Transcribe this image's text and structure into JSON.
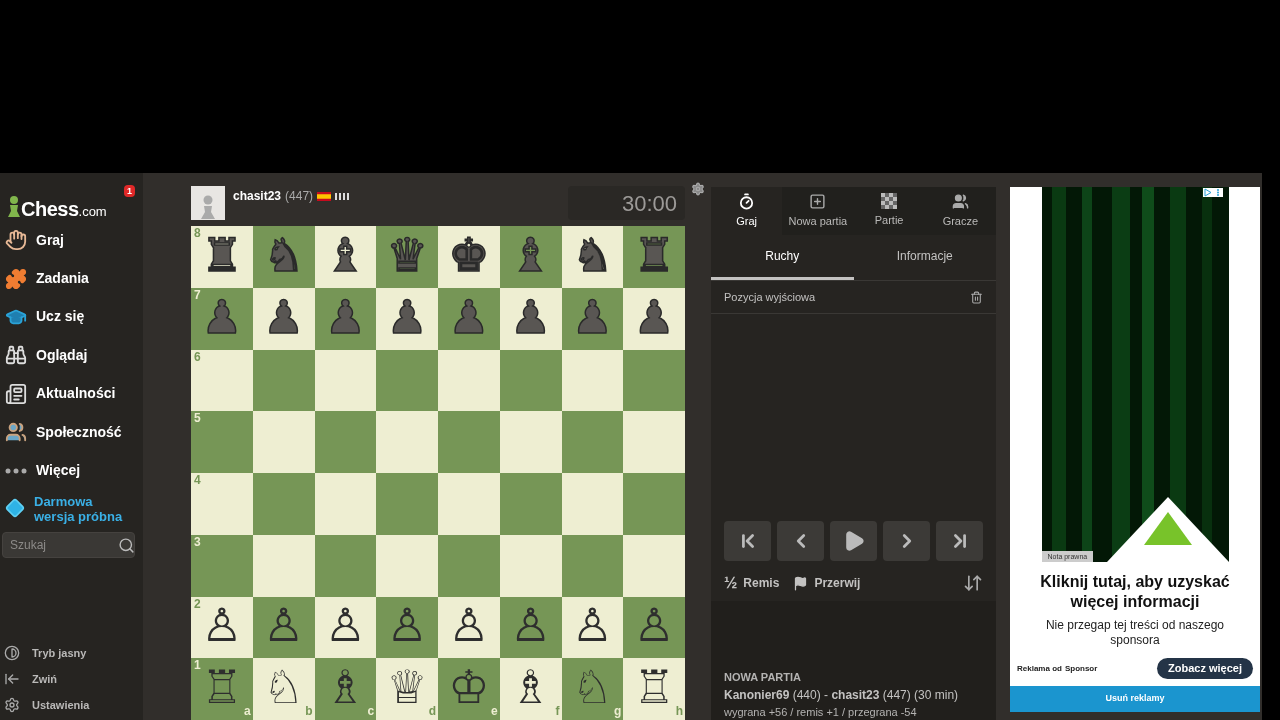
{
  "sidebar": {
    "logo": "Chess",
    "logo_suffix": ".com",
    "notification_count": "1",
    "items": [
      {
        "label": "Graj"
      },
      {
        "label": "Zadania"
      },
      {
        "label": "Ucz się"
      },
      {
        "label": "Oglądaj"
      },
      {
        "label": "Aktualności"
      },
      {
        "label": "Społeczność"
      },
      {
        "label": "Więcej"
      }
    ],
    "trial": "Darmowa wersja próbna",
    "search": {
      "placeholder": "Szukaj"
    },
    "bottom_items": [
      {
        "label": "Tryb jasny"
      },
      {
        "label": "Zwiń"
      },
      {
        "label": "Ustawienia"
      }
    ]
  },
  "player": {
    "name": "chasit23",
    "rating": "(447)",
    "clock": "30:00"
  },
  "board": {
    "ranks": [
      {
        "label": "8",
        "squares": [
          {
            "piece": "♜",
            "kind": "black"
          },
          {
            "piece": "♞",
            "kind": "black"
          },
          {
            "piece": "♝",
            "kind": "black"
          },
          {
            "piece": "♛",
            "kind": "black"
          },
          {
            "piece": "♚",
            "kind": "black"
          },
          {
            "piece": "♝",
            "kind": "black"
          },
          {
            "piece": "♞",
            "kind": "black"
          },
          {
            "piece": "♜",
            "kind": "black"
          }
        ]
      },
      {
        "label": "7",
        "squares": [
          {
            "piece": "♟",
            "kind": "black"
          },
          {
            "piece": "♟",
            "kind": "black"
          },
          {
            "piece": "♟",
            "kind": "black"
          },
          {
            "piece": "♟",
            "kind": "black"
          },
          {
            "piece": "♟",
            "kind": "black"
          },
          {
            "piece": "♟",
            "kind": "black"
          },
          {
            "piece": "♟",
            "kind": "black"
          },
          {
            "piece": "♟",
            "kind": "black"
          }
        ]
      },
      {
        "label": "6"
      },
      {
        "label": "5"
      },
      {
        "label": "4"
      },
      {
        "label": "3"
      },
      {
        "label": "2",
        "squares": [
          {
            "piece": "♙",
            "kind": "white"
          },
          {
            "piece": "♙",
            "kind": "white"
          },
          {
            "piece": "♙",
            "kind": "white"
          },
          {
            "piece": "♙",
            "kind": "white"
          },
          {
            "piece": "♙",
            "kind": "white"
          },
          {
            "piece": "♙",
            "kind": "white"
          },
          {
            "piece": "♙",
            "kind": "white"
          },
          {
            "piece": "♙",
            "kind": "white"
          }
        ]
      },
      {
        "label": "1",
        "squares": [
          {
            "piece": "♖",
            "kind": "white",
            "file": "a"
          },
          {
            "piece": "♘",
            "kind": "white",
            "file": "b"
          },
          {
            "piece": "♗",
            "kind": "white",
            "file": "c"
          },
          {
            "piece": "♕",
            "kind": "white",
            "file": "d"
          },
          {
            "piece": "♔",
            "kind": "white",
            "file": "e"
          },
          {
            "piece": "♗",
            "kind": "white",
            "file": "f"
          },
          {
            "piece": "♘",
            "kind": "white",
            "file": "g"
          },
          {
            "piece": "♖",
            "kind": "white",
            "file": "h"
          }
        ]
      }
    ]
  },
  "panel": {
    "tabs": [
      {
        "label": "Graj",
        "selected": true
      },
      {
        "label": "Nowa partia",
        "selected": false
      },
      {
        "label": "Partie",
        "selected": false
      },
      {
        "label": "Gracze",
        "selected": false
      }
    ],
    "subtabs": [
      {
        "label": "Ruchy",
        "selected": true
      },
      {
        "label": "Informacje",
        "selected": false
      }
    ],
    "start_position": "Pozycja wyjściowa",
    "draw": "Remis",
    "draw_symbol": "½",
    "resign": "Przerwij",
    "game_title": "NOWA PARTIA",
    "game_players": "**Kanonier69** (440) - **chasit23** (447) (30 min)",
    "game_stakes": "wygrana +56 / remis +1 / przegrana -54"
  },
  "ad": {
    "legal": "Nota prawna",
    "headline": "Kliknij tutaj, aby uzyskać więcej informacji",
    "body": "Nie przegap tej treści od naszego sponsora",
    "sponsor_prefix": "Reklama od",
    "sponsor": "Sponsor",
    "cta": "Zobacz więcej",
    "remove": "Usuń reklamy"
  }
}
